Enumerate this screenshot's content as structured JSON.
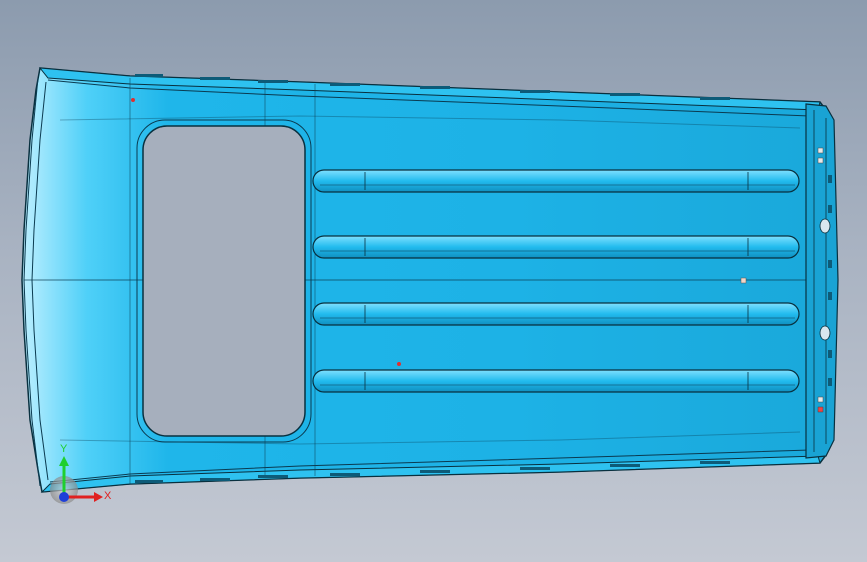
{
  "viewport": {
    "background_top": "#8c9bae",
    "background_bottom": "#c4c9d3"
  },
  "model": {
    "part": "roof-panel",
    "color": "#1eb4e6",
    "edge_color": "#0a2a3a",
    "features": {
      "opening_count": 1,
      "rib_count": 4
    }
  },
  "triad": {
    "y_label": "Y",
    "x_label": "X",
    "y_color": "#1fcf2f",
    "x_color": "#e02020",
    "z_color": "#1f3fd8"
  }
}
